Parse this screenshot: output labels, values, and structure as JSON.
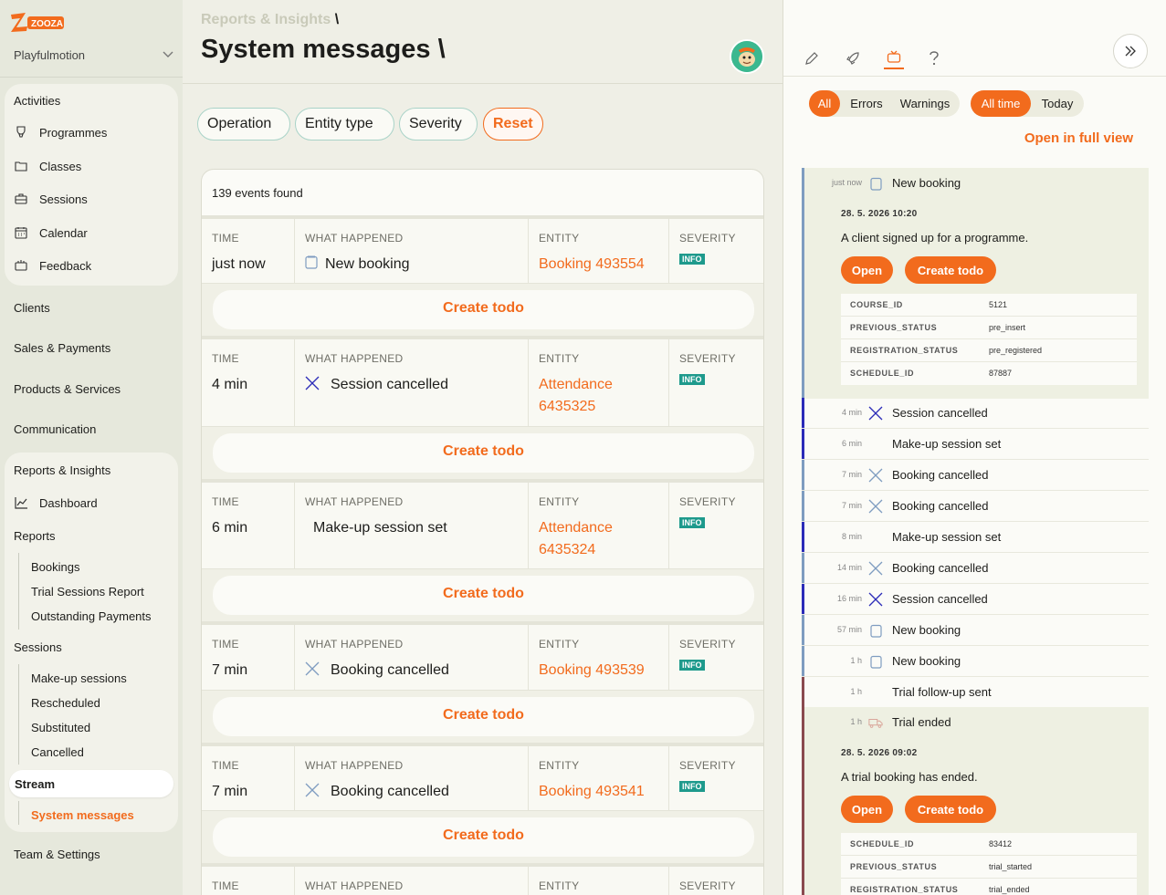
{
  "sidebar": {
    "logo_text": "ZOOZA",
    "org_name": "Playfulmotion",
    "activities": {
      "title": "Activities",
      "items": [
        {
          "label": "Programmes",
          "icon": "trophy-icon"
        },
        {
          "label": "Classes",
          "icon": "folder-icon"
        },
        {
          "label": "Sessions",
          "icon": "briefcase-icon"
        },
        {
          "label": "Calendar",
          "icon": "calendar-icon"
        },
        {
          "label": "Feedback",
          "icon": "feedback-icon"
        }
      ]
    },
    "clients": "Clients",
    "sales": "Sales & Payments",
    "products": "Products & Services",
    "communication": "Communication",
    "reports": {
      "title": "Reports & Insights",
      "dashboard": "Dashboard",
      "reports_title": "Reports",
      "report_items": [
        "Bookings",
        "Trial Sessions Report",
        "Outstanding Payments"
      ],
      "sessions_title": "Sessions",
      "session_items": [
        "Make-up sessions",
        "Rescheduled",
        "Substituted",
        "Cancelled"
      ],
      "stream_title": "Stream",
      "stream_item": "System messages"
    },
    "team": "Team & Settings"
  },
  "main": {
    "breadcrumb": "Reports & Insights",
    "breadcrumb_sep": "\\",
    "title": "System messages",
    "title_sep": "\\",
    "filters": {
      "operation": "Operation",
      "entity_type": "Entity type",
      "severity": "Severity",
      "reset": "Reset"
    },
    "events_count": "139 events found",
    "headers": {
      "time": "TIME",
      "what": "WHAT HAPPENED",
      "entity": "ENTITY",
      "severity": "SEVERITY"
    },
    "create_todo": "Create todo",
    "events": [
      {
        "time": "just now",
        "what": "New booking",
        "icon": "booking-icon",
        "entity": "Booking 493554",
        "severity": "INFO"
      },
      {
        "time": "4 min",
        "what": "Session cancelled",
        "icon": "cross-icon",
        "entity": "Attendance 6435325",
        "severity": "INFO"
      },
      {
        "time": "6 min",
        "what": "Make-up session set",
        "icon": "",
        "entity": "Attendance 6435324",
        "severity": "INFO"
      },
      {
        "time": "7 min",
        "what": "Booking cancelled",
        "icon": "cross-icon",
        "entity": "Booking 493539",
        "severity": "INFO"
      },
      {
        "time": "7 min",
        "what": "Booking cancelled",
        "icon": "cross-icon",
        "entity": "Booking 493541",
        "severity": "INFO"
      }
    ]
  },
  "panel": {
    "tabs": [
      "pencil-icon",
      "rocket-icon",
      "tv-icon",
      "question-icon"
    ],
    "filters": {
      "all": "All",
      "errors": "Errors",
      "warnings": "Warnings",
      "all_time": "All time",
      "today": "Today"
    },
    "open_full_view": "Open in full view",
    "stream": [
      {
        "time": "just now",
        "label": "New booking",
        "color": "#7e9cc0"
      },
      {
        "time": "4 min",
        "label": "Session cancelled",
        "color": "#2b2bb8"
      },
      {
        "time": "6 min",
        "label": "Make-up session set",
        "color": "#2b2bb8"
      },
      {
        "time": "7 min",
        "label": "Booking cancelled",
        "color": "#7e9cc0"
      },
      {
        "time": "7 min",
        "label": "Booking cancelled",
        "color": "#7e9cc0"
      },
      {
        "time": "8 min",
        "label": "Make-up session set",
        "color": "#2b2bb8"
      },
      {
        "time": "14 min",
        "label": "Booking cancelled",
        "color": "#7e9cc0"
      },
      {
        "time": "16 min",
        "label": "Session cancelled",
        "color": "#2b2bb8"
      },
      {
        "time": "57 min",
        "label": "New booking",
        "color": "#7e9cc0"
      },
      {
        "time": "1 h",
        "label": "New booking",
        "color": "#7e9cc0"
      },
      {
        "time": "1 h",
        "label": "Trial follow-up sent",
        "color": "#8a4a4f"
      },
      {
        "time": "1 h",
        "label": "Trial ended",
        "color": "#8a4a4f"
      }
    ],
    "expanded1": {
      "date": "28. 5. 2026 10:20",
      "desc": "A client signed up for a programme.",
      "open": "Open",
      "todo": "Create todo",
      "fields": [
        {
          "k": "COURSE_ID",
          "v": "5121"
        },
        {
          "k": "PREVIOUS_STATUS",
          "v": "pre_insert"
        },
        {
          "k": "REGISTRATION_STATUS",
          "v": "pre_registered"
        },
        {
          "k": "SCHEDULE_ID",
          "v": "87887"
        }
      ]
    },
    "expanded2": {
      "date": "28. 5. 2026 09:02",
      "desc": "A trial booking has ended.",
      "open": "Open",
      "todo": "Create todo",
      "fields": [
        {
          "k": "SCHEDULE_ID",
          "v": "83412"
        },
        {
          "k": "PREVIOUS_STATUS",
          "v": "trial_started"
        },
        {
          "k": "REGISTRATION_STATUS",
          "v": "trial_ended"
        }
      ]
    }
  },
  "colors": {
    "accent": "#f26b1d",
    "info_badge": "#1e9a8c",
    "sidebar_bg": "#e6e8dc"
  }
}
